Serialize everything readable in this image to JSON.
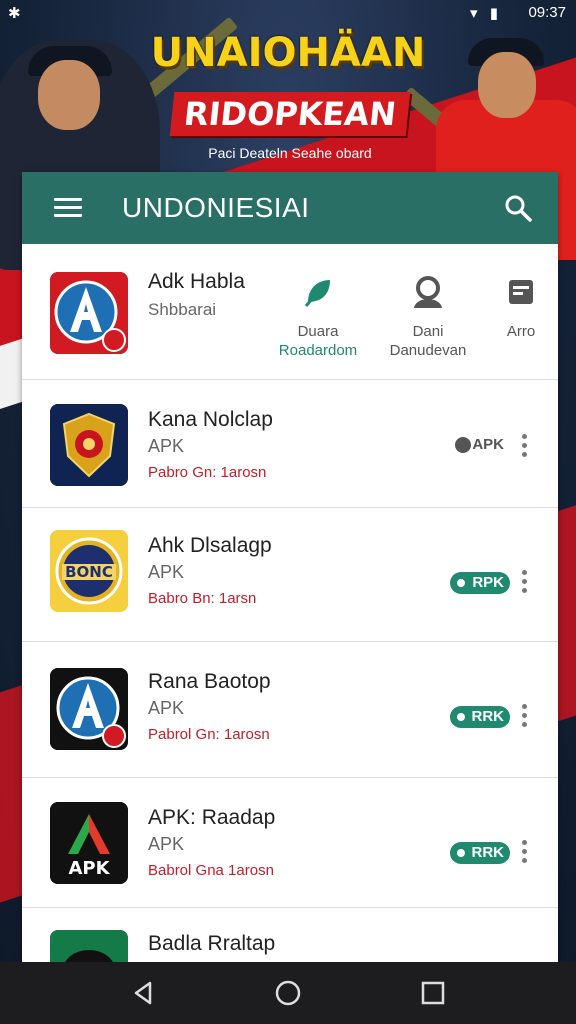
{
  "status_bar": {
    "time": "09:37",
    "icons": "▾ ▮"
  },
  "banner": {
    "title": "UNAIOHÄAN",
    "subtitle": "RIDOPKEAN",
    "tagline": "Paci Deateln Seahe obard"
  },
  "app_bar": {
    "title": "UNDONIESIAI"
  },
  "featured": {
    "name": "Adk Habla",
    "subtitle": "Shbbarai",
    "actions": [
      {
        "label1": "Duara",
        "label2": "Roadardom",
        "icon": "leaf-icon"
      },
      {
        "label1": "Dani",
        "label2": "Danudevan",
        "icon": "person-icon"
      },
      {
        "label1": "Arro",
        "label2": "",
        "icon": "storage-icon"
      }
    ]
  },
  "apps": [
    {
      "name": "Kana Nolclap",
      "type": "APK",
      "meta": "Pabro Gn: 1arosn",
      "badge": "APK",
      "badge_style": "grey",
      "icon": "shield-emblem-icon"
    },
    {
      "name": "Ahk Dlsalagp",
      "type": "APK",
      "meta": "Babro Bn: 1arsn",
      "badge": "RPK",
      "badge_style": "green",
      "icon": "bonc-emblem-icon"
    },
    {
      "name": "Rana Baotop",
      "type": "APK",
      "meta": "Pabrol Gn: 1arosn",
      "badge": "RRK",
      "badge_style": "green",
      "icon": "a-logo-icon"
    },
    {
      "name": "APK: Raadap",
      "type": "APK",
      "meta": "Babrol Gna 1arosn",
      "badge": "RRK",
      "badge_style": "green",
      "icon": "apk-logo-icon"
    },
    {
      "name": "Badla Rraltap",
      "type": "",
      "meta": "",
      "badge": "",
      "badge_style": "",
      "icon": "green-app-icon"
    }
  ],
  "colors": {
    "app_bar": "#2a6f66",
    "accent_green": "#1f8a70",
    "meta_red": "#c0202a",
    "banner_yellow": "#f7d21a",
    "banner_red": "#d31a1f"
  }
}
